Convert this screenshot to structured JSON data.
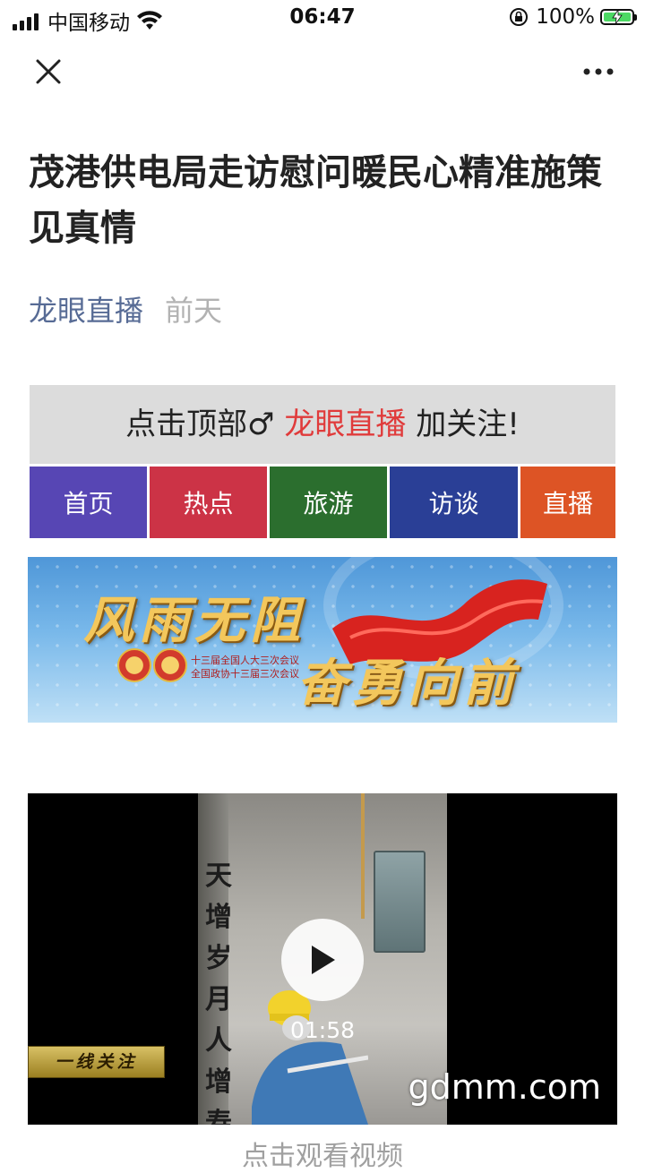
{
  "status_bar": {
    "carrier": "中国移动",
    "time": "06:47",
    "battery_percent": "100%"
  },
  "nav": {
    "close_icon": "close-icon",
    "more_icon": "more-icon"
  },
  "article": {
    "title": "茂港供电局走访慰问暖民心精准施策见真情",
    "author": "龙眼直播",
    "date": "前天"
  },
  "follow_banner": {
    "prefix": "点击顶部♂",
    "brand": "龙眼直播",
    "suffix": "加关注!"
  },
  "tabs": [
    {
      "label": "首页",
      "color": "#5746b4"
    },
    {
      "label": "热点",
      "color": "#cc3346"
    },
    {
      "label": "旅游",
      "color": "#2b6e2e"
    },
    {
      "label": "访谈",
      "color": "#2a3f96"
    },
    {
      "label": "直播",
      "color": "#dd5425"
    }
  ],
  "banner": {
    "slogan_line1": "风雨无阻",
    "slogan_line2": "奋勇向前",
    "session_line1": "十三届全国人大三次会议",
    "session_line2": "全国政协十三届三次会议"
  },
  "video": {
    "calligraphy": "天增岁月人增寿",
    "lower_third": "一线关注",
    "duration": "01:58",
    "watermark": "gdmm.com"
  },
  "below_video_text": "点击观看视频"
}
